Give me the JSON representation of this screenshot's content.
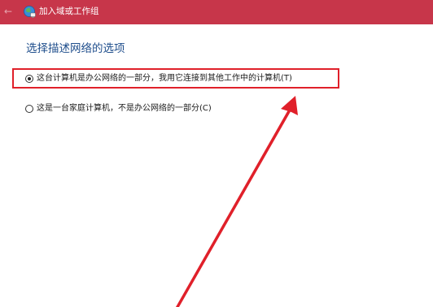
{
  "window": {
    "title": "加入域或工作组",
    "back_icon": "back-arrow-icon",
    "app_icon": "network-globe-icon",
    "titlebar_color": "#c7364a"
  },
  "main": {
    "heading": "选择描述网络的选项",
    "heading_color": "#1f4e8c",
    "options": [
      {
        "label": "这台计算机是办公网络的一部分，我用它连接到其他工作中的计算机(T)",
        "selected": true
      },
      {
        "label": "这是一台家庭计算机，不是办公网络的一部分(C)",
        "selected": false
      }
    ]
  },
  "annotation": {
    "highlight_color": "#e0202a",
    "arrow_color": "#e0202a"
  }
}
